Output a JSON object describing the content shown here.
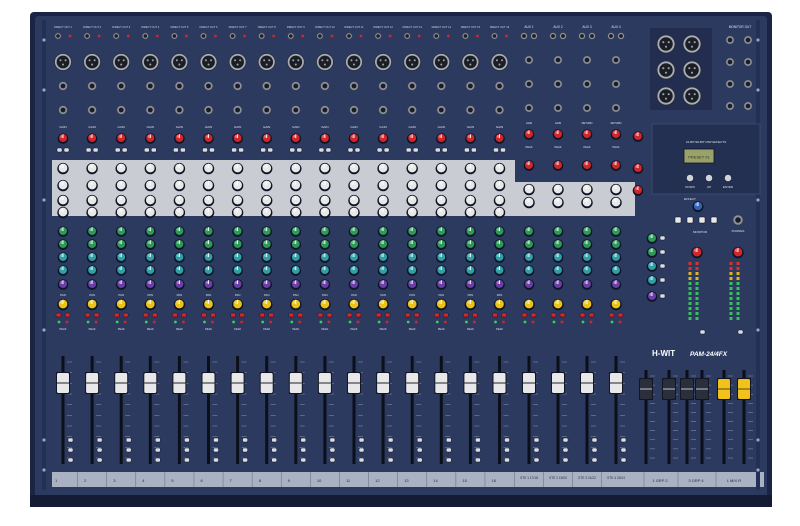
{
  "brand": "H-WIT",
  "model": "PAM-24/4FX",
  "colors": {
    "chassis": "#2c3a60",
    "chassis_dark": "#1c2747",
    "grey_band": "#c9ccd2",
    "knob_red": "#d2262b",
    "knob_green": "#2e9a5a",
    "knob_teal": "#2f9fa8",
    "knob_blue": "#2f63b8",
    "knob_purple": "#6a3fa8",
    "knob_yellow": "#e9c21a",
    "knob_white": "#e8e8e8",
    "fader_yellow": "#f2c21c"
  },
  "mono_channels": [
    {
      "direct": "DIRECT OUT 1",
      "strip": "1"
    },
    {
      "direct": "DIRECT OUT 2",
      "strip": "2"
    },
    {
      "direct": "DIRECT OUT 3",
      "strip": "3"
    },
    {
      "direct": "DIRECT OUT 4",
      "strip": "4"
    },
    {
      "direct": "DIRECT OUT 5",
      "strip": "5"
    },
    {
      "direct": "DIRECT OUT 6",
      "strip": "6"
    },
    {
      "direct": "DIRECT OUT 7",
      "strip": "7"
    },
    {
      "direct": "DIRECT OUT 8",
      "strip": "8"
    },
    {
      "direct": "DIRECT OUT 9",
      "strip": "9"
    },
    {
      "direct": "DIRECT OUT 10",
      "strip": "10"
    },
    {
      "direct": "DIRECT OUT 11",
      "strip": "11"
    },
    {
      "direct": "DIRECT OUT 12",
      "strip": "12"
    },
    {
      "direct": "DIRECT OUT 13",
      "strip": "13"
    },
    {
      "direct": "DIRECT OUT 14",
      "strip": "14"
    },
    {
      "direct": "DIRECT OUT 15",
      "strip": "15"
    },
    {
      "direct": "DIRECT OUT 16",
      "strip": "16"
    }
  ],
  "stereo_channels": [
    {
      "strip": "STE 1 17/18"
    },
    {
      "strip": "STE 2 19/20"
    },
    {
      "strip": "STE 3 21/22"
    },
    {
      "strip": "STE 4 23/24"
    }
  ],
  "group_strips": [
    {
      "label": "1 GRP 2"
    },
    {
      "label": "3 GRP 4"
    },
    {
      "label": "L MIX R"
    }
  ],
  "labels": {
    "gain": "GAIN",
    "peak": "PEAK",
    "pan": "PAN",
    "mute": "MUTE",
    "solo": "SOLO",
    "aux": [
      "AUX 1",
      "AUX 2",
      "AUX 3",
      "AUX 4"
    ],
    "monitor_out": "MONITOR OUT",
    "return": "RETURN",
    "effect": "EFFECT",
    "monitor": "MONITOR",
    "phones": "PHONES",
    "display_caption": "24-BIT/32-BIT DSP EFFECTS",
    "lcd_text": "PRESET 01",
    "buttons": [
      "DOWN",
      "UP",
      "ENTER"
    ]
  }
}
